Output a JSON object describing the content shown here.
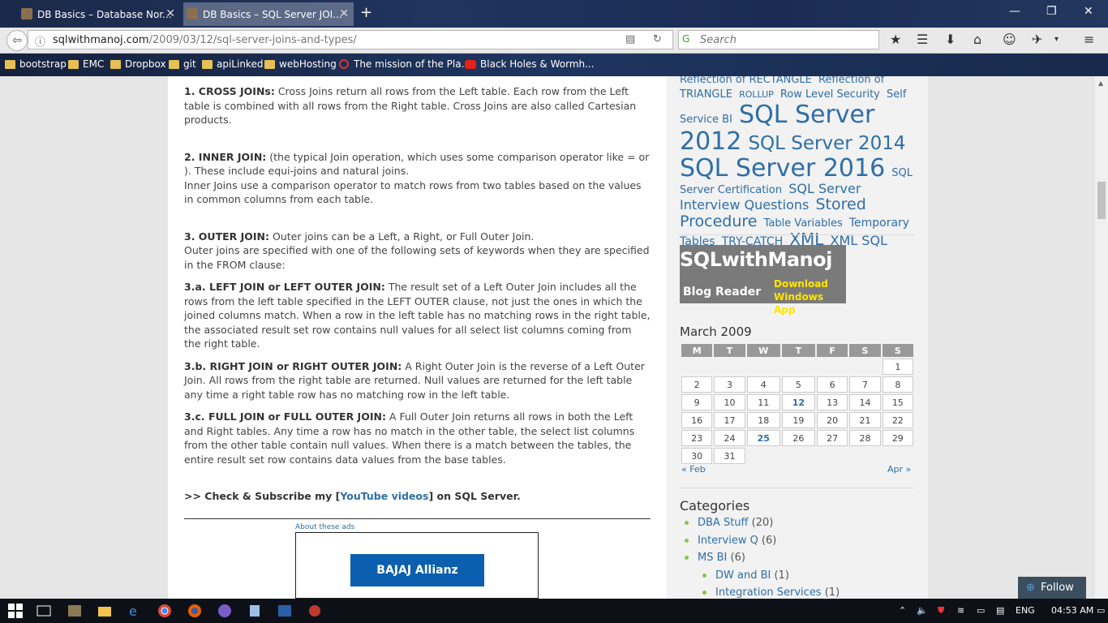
{
  "tabs": [
    {
      "title": "DB Basics – Database Nor..."
    },
    {
      "title": "DB Basics – SQL Server JOI..."
    }
  ],
  "address": {
    "domain": "sqlwithmanoj.com",
    "path": "/2009/03/12/sql-server-joins-and-types/"
  },
  "search": {
    "placeholder": "Search"
  },
  "bookmarks": [
    {
      "label": "bootstrap",
      "kind": "folder"
    },
    {
      "label": "EMC",
      "kind": "folder"
    },
    {
      "label": "Dropbox",
      "kind": "folder"
    },
    {
      "label": "git",
      "kind": "folder"
    },
    {
      "label": "apiLinked",
      "kind": "folder"
    },
    {
      "label": "webHosting",
      "kind": "folder"
    },
    {
      "label": "The mission of the Pla...",
      "kind": "site"
    },
    {
      "label": "Black Holes & Wormh...",
      "kind": "youtube"
    }
  ],
  "article": {
    "cross_title": "1. CROSS JOINs:",
    "cross_text": " Cross Joins return all rows from the Left table. Each row from the Left table is combined with all rows from the Right table. Cross Joins are also called Cartesian products.",
    "inner_title": "2. INNER JOIN:",
    "inner_text": " (the typical Join operation, which uses some comparison operator like = or ). These include equi-joins and natural joins.",
    "inner_text2": "Inner Joins use a comparison operator to match rows from two tables based on the values in common columns from each table.",
    "outer_title": "3. OUTER JOIN:",
    "outer_text": " Outer joins can be a Left, a Right, or Full Outer Join.",
    "outer_text2": "Outer joins are specified with one of the following sets of keywords when they are specified in the FROM clause:",
    "left_title": "3.a. LEFT JOIN or LEFT OUTER JOIN:",
    "left_text": " The result set of a Left Outer Join includes all the rows from the left table specified in the LEFT OUTER clause, not just the ones in which the joined columns match. When a row in the left table has no matching rows in the right table, the associated result set row contains null values for all select list columns coming from the right table.",
    "right_title": "3.b. RIGHT JOIN or RIGHT OUTER JOIN:",
    "right_text": " A Right Outer Join is the reverse of a Left Outer Join. All rows from the right table are returned. Null values are returned for the left table any time a right table row has no matching row in the left table.",
    "full_title": "3.c. FULL JOIN or FULL OUTER JOIN:",
    "full_text": " A Full Outer Join returns all rows in both the Left and Right tables. Any time a row has no match in the other table, the select list columns from the other table contain null values. When there is a match between the tables, the entire result set row contains data values from the base tables.",
    "subscribe_pre": ">> Check & Subscribe my [",
    "subscribe_link": "YouTube videos",
    "subscribe_post": "] on SQL Server.",
    "ads_label": "About these ads",
    "ad_brand": "BAJAJ Allianz"
  },
  "tagcloud": [
    {
      "text": "Reflection of RECTANGLE",
      "size": 13
    },
    {
      "text": "Reflection of TRIANGLE",
      "size": 13
    },
    {
      "text": "ROLLUP",
      "size": 11
    },
    {
      "text": "Row Level Security",
      "size": 13
    },
    {
      "text": "Self Service BI",
      "size": 13
    },
    {
      "text": "SQL Server 2012",
      "size": 30
    },
    {
      "text": "SQL Server 2014",
      "size": 23
    },
    {
      "text": "SQL Server 2016",
      "size": 30
    },
    {
      "text": "SQL Server Certification",
      "size": 13
    },
    {
      "text": "SQL Server Interview Questions",
      "size": 16
    },
    {
      "text": "Stored Procedure",
      "size": 19
    },
    {
      "text": "Table Variables",
      "size": 13
    },
    {
      "text": "Temporary Tables",
      "size": 14
    },
    {
      "text": "TRY-CATCH",
      "size": 14
    },
    {
      "text": "XML",
      "size": 20
    },
    {
      "text": "XML SQL",
      "size": 16
    }
  ],
  "badge": {
    "title": "SQLwithManoj",
    "reader": "Blog Reader",
    "download1": "Download",
    "download2": "Windows App"
  },
  "calendar": {
    "caption": "March 2009",
    "days": [
      "M",
      "T",
      "W",
      "T",
      "F",
      "S",
      "S"
    ],
    "weeks": [
      [
        "",
        "",
        "",
        "",
        "",
        "",
        "1"
      ],
      [
        "2",
        "3",
        "4",
        "5",
        "6",
        "7",
        "8"
      ],
      [
        "9",
        "10",
        "11",
        "12",
        "13",
        "14",
        "15"
      ],
      [
        "16",
        "17",
        "18",
        "19",
        "20",
        "21",
        "22"
      ],
      [
        "23",
        "24",
        "25",
        "26",
        "27",
        "28",
        "29"
      ],
      [
        "30",
        "31",
        "",
        "",
        "",
        "",
        ""
      ]
    ],
    "links": [
      "12",
      "25"
    ],
    "prev": "« Feb",
    "next": "Apr »"
  },
  "categories": {
    "heading": "Categories",
    "items": [
      {
        "name": "DBA Stuff",
        "count": "(20)",
        "sub": false
      },
      {
        "name": "Interview Q",
        "count": "(6)",
        "sub": false
      },
      {
        "name": "MS BI",
        "count": "(6)",
        "sub": false
      },
      {
        "name": "DW and BI",
        "count": "(1)",
        "sub": true
      },
      {
        "name": "Integration Services",
        "count": "(1)",
        "sub": true
      }
    ]
  },
  "follow": {
    "label": "Follow"
  },
  "taskbar": {
    "lang": "ENG",
    "time": "04:53 AM"
  }
}
